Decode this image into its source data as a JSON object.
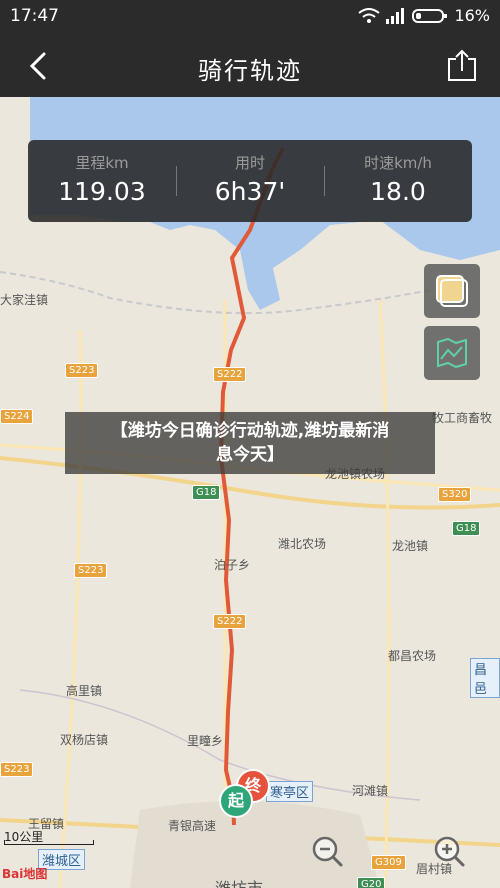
{
  "status_bar": {
    "time": "17:47",
    "battery": "16%"
  },
  "header": {
    "title": "骑行轨迹"
  },
  "stats": {
    "distance": {
      "label": "里程km",
      "value": "119.03"
    },
    "duration": {
      "label": "用时",
      "value": "6h37'"
    },
    "speed": {
      "label": "时速km/h",
      "value": "18.0"
    }
  },
  "banner": {
    "line1": "【潍坊今日确诊行动轨迹,潍坊最新消",
    "line2": "息今天】"
  },
  "map": {
    "labels": {
      "town_dajiawa": "大家洼镇",
      "farm_muyi": "牧工商畜牧",
      "farm_longchi": "龙池镇农场",
      "farm_weibei": "潍北农场",
      "town_longchi": "龙池镇",
      "town_yangzi": "泊子乡",
      "farm_dubei": "都昌农场",
      "town_gaoli": "高里镇",
      "town_shuangyang": "双杨店镇",
      "town_lizhuang": "里疃乡",
      "town_hanting": "寒亭区",
      "town_hetan": "河滩镇",
      "town_wangliu": "王留镇",
      "town_qingyin": "青银高速",
      "district_weicheng": "潍城区",
      "city_weifang": "潍坊市",
      "town_meiliu": "眉村镇",
      "town_changyi": "昌邑"
    },
    "shields": {
      "s223a": "S223",
      "s222a": "S222",
      "s224": "S224",
      "g18a": "G18",
      "s320": "S320",
      "g18b": "G18",
      "s223b": "S223",
      "s222b": "S222",
      "s223c": "S223",
      "g309": "G309",
      "g20": "G20"
    },
    "start_marker": "起",
    "end_marker": "终",
    "scale": "10公里",
    "logo": "Bai地图"
  }
}
